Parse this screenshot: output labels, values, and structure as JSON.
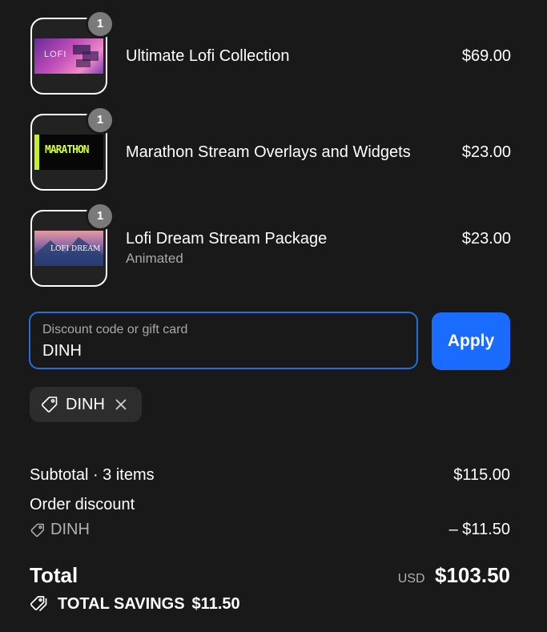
{
  "items": [
    {
      "title": "Ultimate Lofi Collection",
      "price": "$69.00",
      "quantity": "1",
      "variant": "",
      "thumb_text": "LOFI"
    },
    {
      "title": "Marathon Stream Overlays and Widgets",
      "price": "$23.00",
      "quantity": "1",
      "variant": "",
      "thumb_text": "MARATHON"
    },
    {
      "title": "Lofi Dream Stream Package",
      "price": "$23.00",
      "quantity": "1",
      "variant": "Animated",
      "thumb_text": "LOFI DREAM"
    }
  ],
  "discount": {
    "placeholder": "Discount code or gift card",
    "value": "DINH",
    "apply_label": "Apply",
    "applied_code": "DINH"
  },
  "summary": {
    "subtotal_label": "Subtotal · 3 items",
    "subtotal_value": "$115.00",
    "order_discount_label": "Order discount",
    "discount_code": "DINH",
    "discount_value": "– $11.50",
    "total_label": "Total",
    "currency": "USD",
    "total_value": "$103.50",
    "savings_label": "TOTAL SAVINGS",
    "savings_value": "$11.50"
  },
  "colors": {
    "background": "#191919",
    "accent": "#1a6bff",
    "field_border": "#1f6fe0",
    "chip": "#2d2d2d",
    "muted": "#a8a8a8"
  }
}
